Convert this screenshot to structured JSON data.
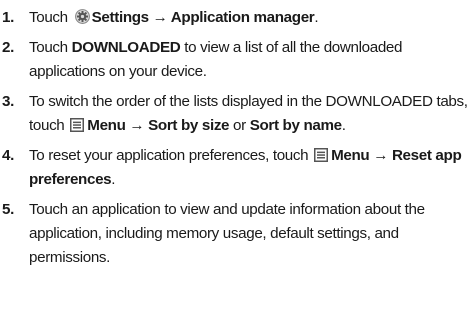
{
  "steps": [
    {
      "number": "1.",
      "t1": "Touch ",
      "icon": "settings-gear-icon",
      "b1": "Settings → Application manager",
      "t2": "."
    },
    {
      "number": "2.",
      "t1": "Touch ",
      "b1": "DOWNLOADED",
      "t2": " to view a list of all the downloaded applications on your device."
    },
    {
      "number": "3.",
      "t1": "To switch the order of the lists displayed in the DOWNLOADED tabs, touch ",
      "icon": "menu-icon",
      "b1": "Menu → Sort by size",
      "t2": " or ",
      "b2": "Sort by name",
      "t3": "."
    },
    {
      "number": "4.",
      "t1": "To reset your application preferences, touch ",
      "icon": "menu-icon",
      "b1": "Menu → Reset app preferences",
      "t2": "."
    },
    {
      "number": "5.",
      "t1": "Touch an application to view and update information about the application, including memory usage, default settings, and permissions."
    }
  ]
}
